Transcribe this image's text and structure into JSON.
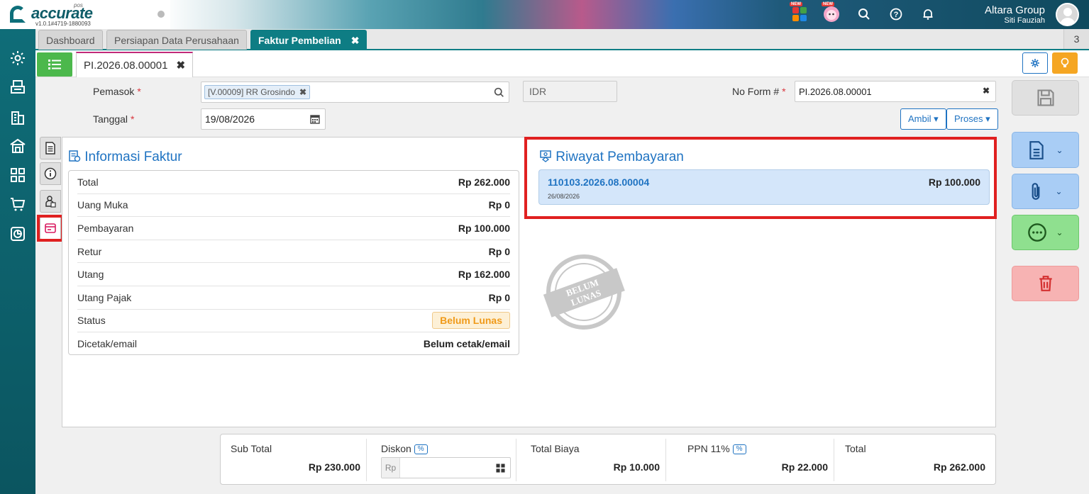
{
  "header": {
    "logo": "accurate",
    "logo_sub": "pos",
    "version": "v1.0.1#4719-1880093",
    "new_badge": "NEW",
    "company": "Altara Group",
    "user": "Siti Fauziah"
  },
  "tabs": [
    {
      "label": "Dashboard"
    },
    {
      "label": "Persiapan Data Perusahaan"
    },
    {
      "label": "Faktur Pembelian",
      "close": "✖"
    }
  ],
  "tab_count": "3",
  "document_tab": {
    "label": "PI.2026.08.00001",
    "close": "✖"
  },
  "form": {
    "supplier_label": "Pemasok",
    "supplier_value": "[V.00009] RR Grosindo",
    "supplier_remove": "✖",
    "currency": "IDR",
    "date_label": "Tanggal",
    "date_value": "19/08/2026",
    "form_no_label": "No Form #",
    "form_no_value": "PI.2026.08.00001",
    "required_mark": "*",
    "clear": "✖",
    "ambil": "Ambil",
    "proses": "Proses"
  },
  "info": {
    "title": "Informasi Faktur",
    "rows": [
      {
        "label": "Total",
        "value": "Rp 262.000"
      },
      {
        "label": "Uang Muka",
        "value": "Rp 0"
      },
      {
        "label": "Pembayaran",
        "value": "Rp 100.000"
      },
      {
        "label": "Retur",
        "value": "Rp 0"
      },
      {
        "label": "Utang",
        "value": "Rp 162.000"
      },
      {
        "label": "Utang Pajak",
        "value": "Rp 0"
      },
      {
        "label": "Status",
        "value": "Belum Lunas"
      },
      {
        "label": "Dicetak/email",
        "value": "Belum cetak/email"
      }
    ]
  },
  "payment_history": {
    "title": "Riwayat Pembayaran",
    "items": [
      {
        "number": "110103.2026.08.00004",
        "amount": "Rp 100.000",
        "date": "26/08/2026"
      }
    ]
  },
  "stamp": {
    "line1": "BELUM",
    "line2": "LUNAS"
  },
  "totals": {
    "subtotal_label": "Sub Total",
    "subtotal_value": "Rp 230.000",
    "discount_label": "Diskon",
    "discount_badge": "%",
    "discount_placeholder": "Rp",
    "biaya_label": "Total Biaya",
    "biaya_value": "Rp 10.000",
    "ppn_label": "PPN 11%",
    "ppn_badge": "%",
    "ppn_value": "Rp 22.000",
    "total_label": "Total",
    "total_value": "Rp 262.000"
  },
  "colors": {
    "accent": "#1f73c2",
    "teal": "#0e7d84",
    "highlight": "#e02020",
    "status": "#f09a1a"
  }
}
